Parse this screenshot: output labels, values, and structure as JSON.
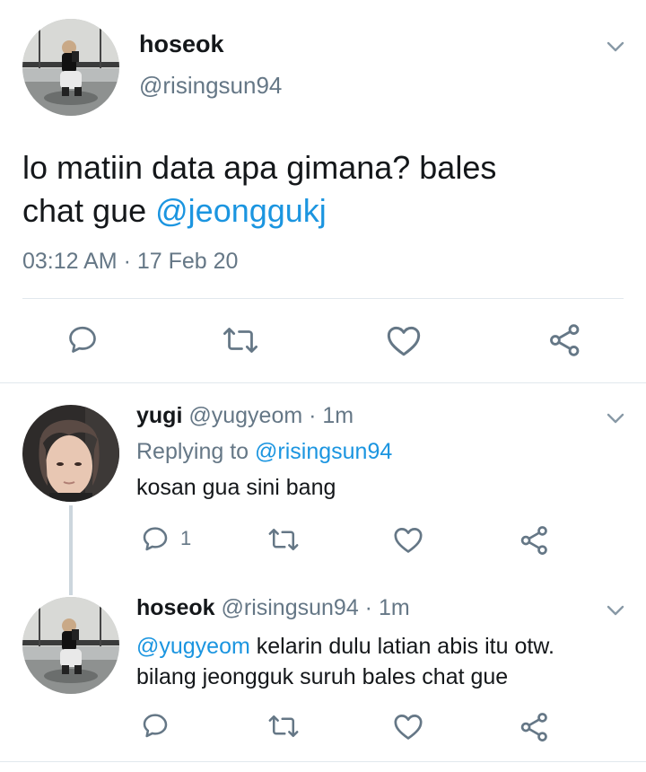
{
  "main_tweet": {
    "display_name": "hoseok",
    "handle": "@risingsun94",
    "text_line1": "lo matiin data apa gimana? bales",
    "text_line2_prefix": "chat gue ",
    "text_mention": "@jeonggukj",
    "timestamp": "03:12 AM · 17 Feb 20"
  },
  "replies": [
    {
      "display_name": "yugi",
      "handle": "@yugyeom",
      "time": " · 1m",
      "replying_prefix": "Replying to ",
      "replying_to": "@risingsun94",
      "text": "kosan gua sini bang",
      "reply_count": "1"
    },
    {
      "display_name": "hoseok",
      "handle": "@risingsun94",
      "time": " · 1m",
      "mention": "@yugyeom",
      "text_line1_rest": " kelarin dulu latian abis itu otw.",
      "text_line2": "bilang jeongguk suruh bales chat gue"
    }
  ],
  "icons": {
    "reply": "speech-bubble-icon",
    "retweet": "retweet-icon",
    "like": "heart-icon",
    "share": "share-icon",
    "menu": "chevron-down-icon"
  },
  "colors": {
    "link": "#1b95e0",
    "muted": "#657786",
    "text": "#14171a",
    "divider": "#e1e8ed"
  }
}
